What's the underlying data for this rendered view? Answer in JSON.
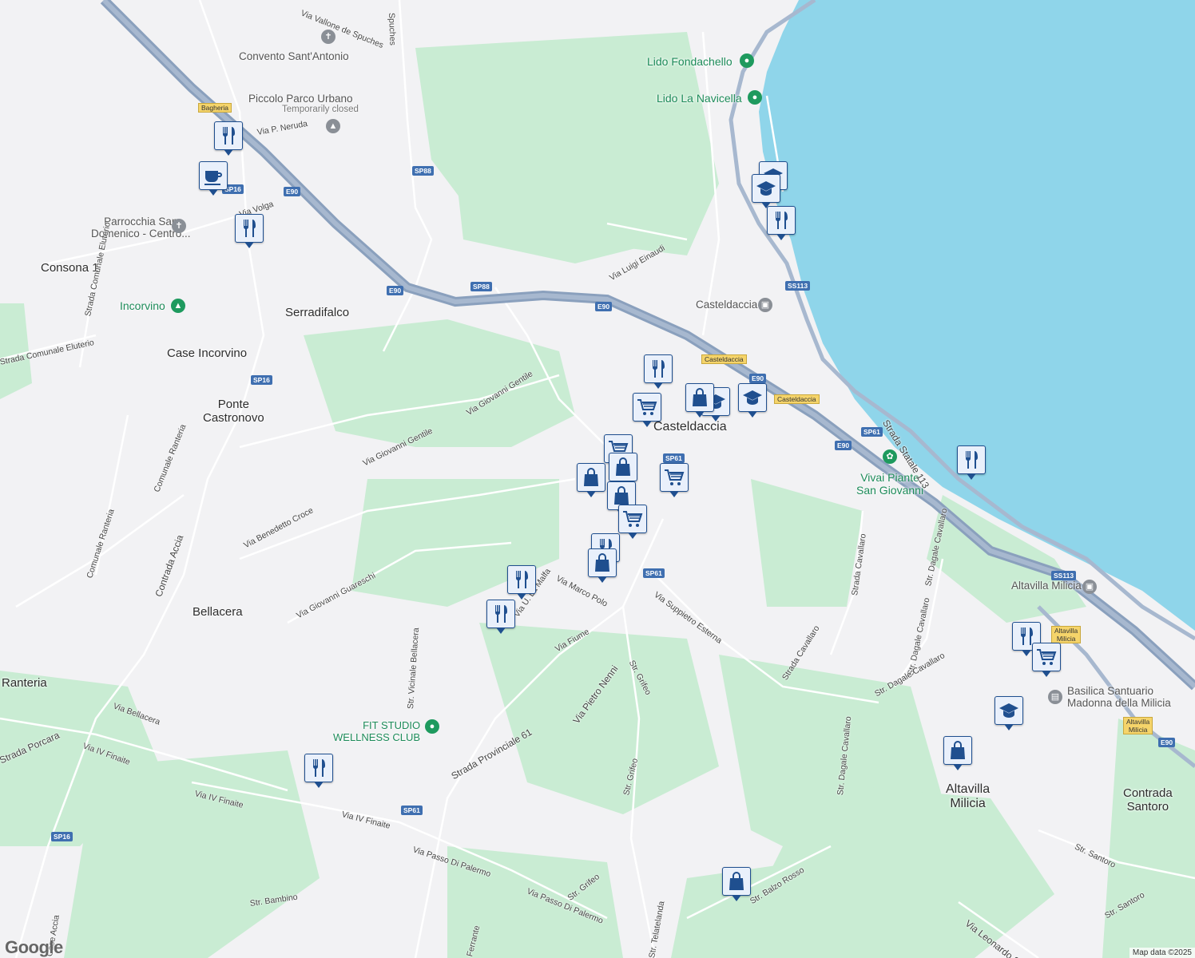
{
  "map": {
    "places": {
      "consona": "Consona 1",
      "serradifalco": "Serradifalco",
      "case_incorvino": "Case Incorvino",
      "ponte_castronovo": "Ponte\nCastronovo",
      "bellacera": "Bellacera",
      "ranteria": "Ranteria",
      "casteldaccia_center": "Casteldaccia",
      "altavilla": "Altavilla\nMilicia",
      "contrada_santoro": "Contrada\nSantoro"
    },
    "pois": {
      "convento": "Convento Sant'Antonio",
      "piccolo_parco": "Piccolo Parco Urbano",
      "piccolo_parco_status": "Temporarily closed",
      "parrocchia": "Parrocchia San\nDomenico - Centro...",
      "incorvino": "Incorvino",
      "lido_fondachello": "Lido Fondachello",
      "lido_navicella": "Lido La Navicella",
      "casteldaccia_station": "Casteldaccia",
      "vivai": "Vivai Piante\nSan Giovanni",
      "altavilla_station": "Altavilla Milicia",
      "basilica": "Basilica Santuario\nMadonna della Milicia",
      "fit_studio": "FIT STUDIO\nWELLNESS CLUB"
    },
    "roads": {
      "vallone": "Via Vallone de Spuches",
      "spuches": "Spuches",
      "neruda": "Via P. Neruda",
      "volga": "Via Volga",
      "eluterio1": "Strada Comunale Eluterio",
      "eluterio2": "Strada Comunale Eluterio",
      "einaudi": "Via Luigi Einaudi",
      "gentile1": "Via Giovanni Gentile",
      "gentile2": "Via Giovanni Gentile",
      "ranteria1": "Comunale Ranteria",
      "ranteria2": "Comunale Ranteria",
      "croce": "Via Benedetto Croce",
      "accia": "Contrada Accia",
      "guareschi": "Via Giovanni Guareschi",
      "lamalfa": "Via U. La Malfa",
      "marcopolo": "Via Marco Polo",
      "fiume": "Via Fiume",
      "nenni": "Via Pietro Nenni",
      "grifeo1": "Str. Grifeo",
      "grifeo2": "Str. Grifeo",
      "grifeo3": "Str. Grifeo",
      "suppietro": "Via Suppietro Esterna",
      "cavallaro1": "Strada Cavallaro",
      "cavallaro2": "Strada Cavallaro",
      "dagale1": "Str. Dagale Cavallaro",
      "dagale2": "Str. Dagale Cavallaro",
      "dagale3": "Str. Dagale Cavallaro",
      "statale": "Strada Statale 113",
      "bellacera_rd": "Via Bellacera",
      "vicinale": "Str. Vicinale Bellacera",
      "sp61": "Strada Provinciale 61",
      "porcara": "Strada Porcara",
      "finaite1": "Via IV Finaite",
      "finaite2": "Via IV Finaite",
      "finaite3": "Via IV Finaite",
      "passo1": "Via Passo Di Palermo",
      "passo2": "Via Passo Di Palermo",
      "bambino": "Str. Bambino",
      "telatelanda": "Str. Telatelanda",
      "balzo": "Str. Balzo Rosso",
      "ferrante": "Ferrante",
      "santoro1": "Str. Santoro",
      "santoro2": "Str. Santoro",
      "leonardo": "Via Leonardo Sc",
      "accia2": "Case Accia"
    },
    "shields": {
      "sp88a": "SP88",
      "sp88b": "SP88",
      "e90a": "E90",
      "e90b": "E90",
      "e90c": "E90",
      "e90d": "E90",
      "e90e": "E90",
      "e90f": "E90",
      "sp16a": "SP16",
      "sp16b": "SP16",
      "sp16c": "SP16",
      "sp61a": "SP61",
      "sp61b": "SP61",
      "sp61c": "SP61",
      "ss113a": "SS113",
      "ss113b": "SS113",
      "bagheria": "Bagheria",
      "casteldaccia1": "Casteldaccia",
      "casteldaccia2": "Casteldaccia",
      "altavilla_sign": "Altavilla\nMilicia",
      "altavilla_sign2": "Altavilla\nMilicia"
    },
    "branding": {
      "logo": "Google",
      "attribution": "Map data ©2025"
    },
    "colors": {
      "sea": "#8fd5ea",
      "green": "#c9ecd3",
      "land": "#f2f2f4",
      "highway": "#8aa0bd",
      "marker": "#1f4f8f"
    },
    "markers": [
      {
        "icon": "restaurant-icon"
      },
      {
        "icon": "cafe-icon"
      },
      {
        "icon": "restaurant-icon"
      },
      {
        "icon": "school-icon"
      },
      {
        "icon": "restaurant-icon"
      },
      {
        "icon": "restaurant-icon"
      },
      {
        "icon": "school-icon"
      },
      {
        "icon": "school-icon"
      },
      {
        "icon": "shopping-cart-icon"
      },
      {
        "icon": "school-icon"
      },
      {
        "icon": "shopping-cart-icon"
      },
      {
        "icon": "shopping-bag-icon"
      },
      {
        "icon": "shopping-bag-icon"
      },
      {
        "icon": "shopping-cart-icon"
      },
      {
        "icon": "shopping-bag-icon"
      },
      {
        "icon": "shopping-cart-icon"
      },
      {
        "icon": "restaurant-icon"
      },
      {
        "icon": "shopping-bag-icon"
      },
      {
        "icon": "restaurant-icon"
      },
      {
        "icon": "restaurant-icon"
      },
      {
        "icon": "restaurant-icon"
      },
      {
        "icon": "restaurant-icon"
      },
      {
        "icon": "restaurant-icon"
      },
      {
        "icon": "shopping-cart-icon"
      },
      {
        "icon": "school-icon"
      },
      {
        "icon": "shopping-bag-icon"
      },
      {
        "icon": "shopping-bag-icon"
      },
      {
        "icon": "shopping-bag-icon"
      }
    ]
  }
}
